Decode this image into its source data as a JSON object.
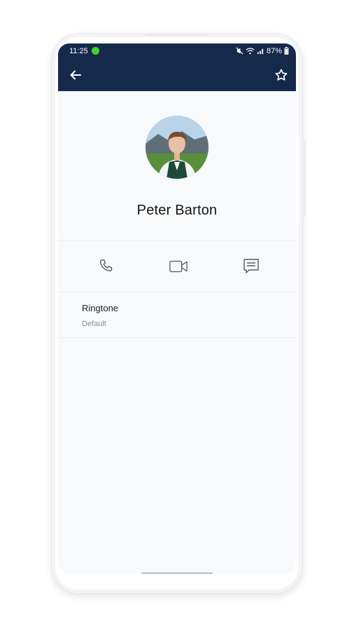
{
  "status_bar": {
    "time": "11:25",
    "battery": "87%",
    "icons": [
      "mute-icon",
      "wifi-icon",
      "signal-icon",
      "battery-icon"
    ]
  },
  "app_bar": {
    "back_icon": "back-arrow-icon",
    "favorite_icon": "star-outline-icon"
  },
  "contact": {
    "name": "Peter Barton"
  },
  "actions": [
    {
      "icon": "phone-icon"
    },
    {
      "icon": "video-call-icon"
    },
    {
      "icon": "message-icon"
    }
  ],
  "settings": [
    {
      "title": "Ringtone",
      "value": "Default"
    }
  ],
  "colors": {
    "header": "#15294b",
    "background": "#f8f9fb",
    "status_dot": "#41d629"
  }
}
